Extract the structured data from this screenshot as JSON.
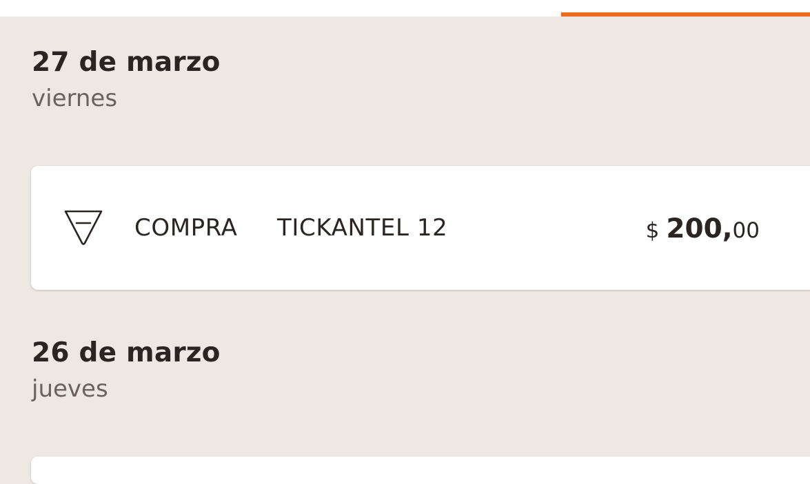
{
  "tabs": {
    "active_indicator_color": "#ec6b1f"
  },
  "days": [
    {
      "date": "27 de marzo",
      "weekday": "viernes",
      "transactions": [
        {
          "icon": "purchase-triangle-icon",
          "type": "COMPRA",
          "description": "TICKANTEL 12",
          "amount": {
            "currency": "$",
            "integer": "200,",
            "decimals": "00"
          }
        }
      ]
    },
    {
      "date": "26 de marzo",
      "weekday": "jueves",
      "transactions": []
    }
  ]
}
